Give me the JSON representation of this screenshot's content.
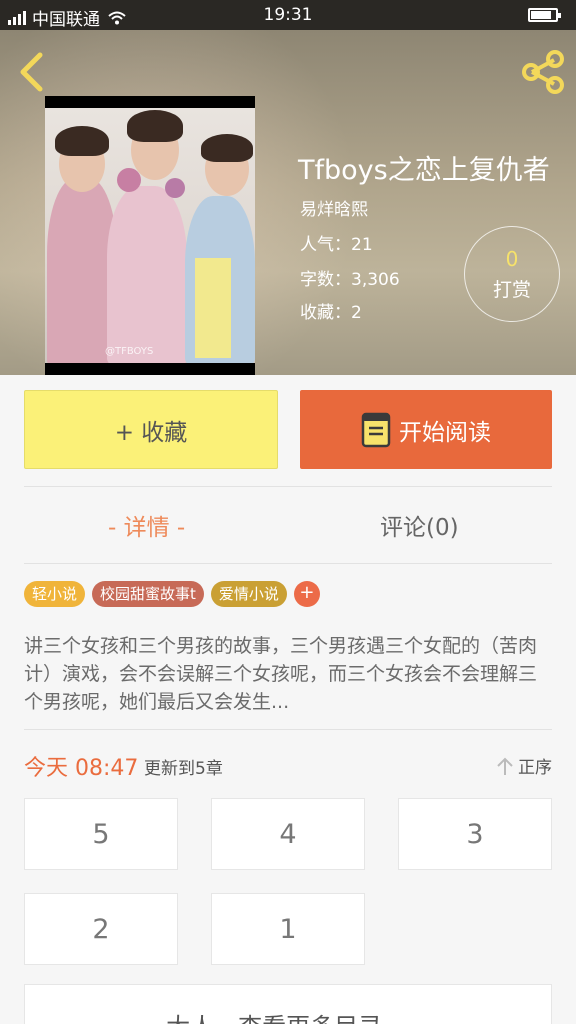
{
  "status_bar": {
    "carrier": "中国联通",
    "time": "19:31"
  },
  "hero": {
    "title": "Tfboys之恋上复仇者",
    "author": "易烊晗熙",
    "popularity": "人气：21",
    "word_count": "字数：3,306",
    "favorites": "收藏：2",
    "reward_count": "0",
    "reward_label": "打赏",
    "cover_watermark": "@TFBOYS"
  },
  "actions": {
    "collect_label": "+ 收藏",
    "read_label": "开始阅读"
  },
  "tabs": {
    "detail": "- 详情 -",
    "comment": "评论(0)"
  },
  "tags": [
    "轻小说",
    "校园甜蜜故事t",
    "爱情小说"
  ],
  "tag_add": "+",
  "summary": "讲三个女孩和三个男孩的故事，三个男孩遇三个女配的（苦肉计）演戏，会不会误解三个女孩呢，而三个女孩会不会理解三个男孩呢，她们最后又会发生...",
  "chapters_header": {
    "time": "今天 08:47",
    "update": "更新到5章",
    "order": "正序"
  },
  "chapters": [
    "5",
    "4",
    "3",
    "2",
    "1"
  ],
  "more": "大人，查看更多目录 ⌄",
  "colors": {
    "accent": "#e8693c",
    "collect_bg": "#fbf178",
    "tab_active": "#ee8a5a"
  }
}
